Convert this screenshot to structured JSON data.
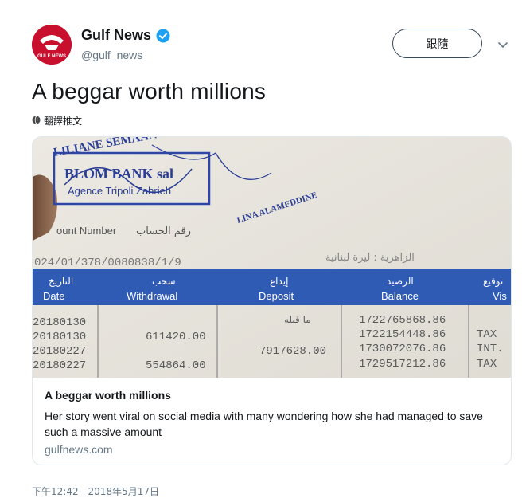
{
  "account": {
    "name": "Gulf News",
    "handle": "@gulf_news",
    "avatar_text": "GULF NEWS",
    "verified": true
  },
  "follow_button": {
    "label": "跟隨"
  },
  "tweet": {
    "text": "A beggar worth millions",
    "translate_label": "翻譯推文",
    "timestamp": "下午12:42 - 2018年5月17日"
  },
  "card": {
    "title": "A beggar worth millions",
    "description": "Her story went viral on social media with many wondering how she had managed to save such a massive amount",
    "domain": "gulfnews.com",
    "image": {
      "stamp_line1": "LILIANE SEMAAN",
      "stamp_line2": "BLOM BANK sal",
      "stamp_line3": "Agence Tripoli Zahrieh",
      "signature_name": "LINA ALAMEDDINE",
      "account_number_label": "ount Number",
      "account_number_label_ar": "رقم الحساب",
      "account_number": "024/01/378/0080838/1/9",
      "branch_ar": "الزاهرية : ليرة لبنانية",
      "headers": [
        {
          "ar": "التاريخ",
          "en": "Date"
        },
        {
          "ar": "سحب",
          "en": "Withdrawal"
        },
        {
          "ar": "إيداع",
          "en": "Deposit"
        },
        {
          "ar": "الرصيد",
          "en": "Balance"
        },
        {
          "ar": "توقيع",
          "en": "Vis"
        }
      ],
      "rows": [
        {
          "date": "20180130",
          "withdrawal": "",
          "deposit": "ما قبله",
          "balance": "1722765868.86",
          "note": ""
        },
        {
          "date": "20180130",
          "withdrawal": "611420.00",
          "deposit": "",
          "balance": "1722154448.86",
          "note": "TAX"
        },
        {
          "date": "20180227",
          "withdrawal": "",
          "deposit": "7917628.00",
          "balance": "1730072076.86",
          "note": "INT."
        },
        {
          "date": "20180227",
          "withdrawal": "554864.00",
          "deposit": "",
          "balance": "1729517212.86",
          "note": "TAX"
        }
      ]
    }
  },
  "colors": {
    "bank_header": "#2f5bb5",
    "brand_red": "#c8102e",
    "verified_blue": "#1da1f2",
    "muted": "#657786"
  }
}
